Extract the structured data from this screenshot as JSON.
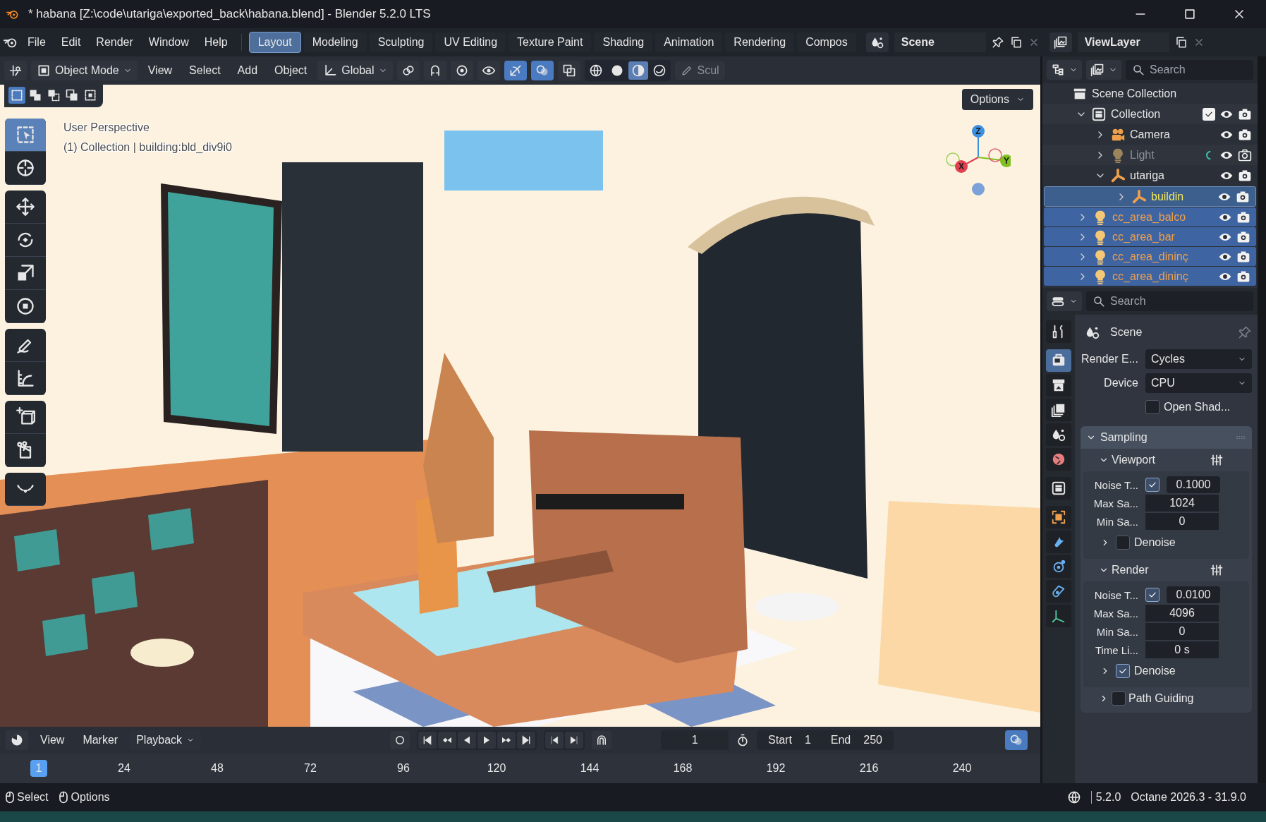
{
  "window": {
    "title": "* habana [Z:\\code\\utariga\\exported_back\\habana.blend] - Blender 5.2.0 LTS"
  },
  "menu": [
    "File",
    "Edit",
    "Render",
    "Window",
    "Help"
  ],
  "workspaces": [
    {
      "label": "Layout",
      "selected": true
    },
    {
      "label": "Modeling",
      "selected": false
    },
    {
      "label": "Sculpting",
      "selected": false
    },
    {
      "label": "UV Editing",
      "selected": false
    },
    {
      "label": "Texture Paint",
      "selected": false
    },
    {
      "label": "Shading",
      "selected": false
    },
    {
      "label": "Animation",
      "selected": false
    },
    {
      "label": "Rendering",
      "selected": false
    },
    {
      "label": "Compos",
      "selected": false
    }
  ],
  "scene": {
    "name": "Scene"
  },
  "view_layer": {
    "name": "ViewLayer"
  },
  "viewport_header": {
    "mode": "Object Mode",
    "menus": [
      "View",
      "Select",
      "Add",
      "Object"
    ],
    "orientation": "Global",
    "toggles": [
      {
        "kind": "snap",
        "on": false
      },
      {
        "kind": "proportional",
        "on": false
      },
      {
        "kind": "visibility",
        "on": false
      },
      {
        "kind": "gizmo",
        "on": true
      },
      {
        "kind": "overlay",
        "on": true
      },
      {
        "kind": "xray",
        "on": false
      }
    ],
    "shading": [
      {
        "kind": "wireframe",
        "selected": false
      },
      {
        "kind": "solid",
        "selected": false
      },
      {
        "kind": "material",
        "selected": true
      },
      {
        "kind": "rendered",
        "selected": false
      }
    ],
    "sculpt": "Scul"
  },
  "viewport": {
    "options": "Options",
    "perspective": "User Perspective",
    "info": "(1) Collection | building:bld_div9i0",
    "select_modes": [
      {
        "kind": "new",
        "selected": true
      },
      {
        "kind": "extend",
        "selected": false
      },
      {
        "kind": "subtract",
        "selected": false
      },
      {
        "kind": "invert",
        "selected": false
      },
      {
        "kind": "intersect",
        "selected": false
      }
    ],
    "tools": [
      {
        "kind": "select",
        "selected": true
      },
      {
        "kind": "cursor",
        "selected": false
      },
      {
        "kind": "move",
        "selected": false
      },
      {
        "kind": "rotate",
        "selected": false
      },
      {
        "kind": "scale",
        "selected": false
      },
      {
        "kind": "transform",
        "selected": false
      },
      {
        "kind": "annotate",
        "selected": false
      },
      {
        "kind": "measure",
        "selected": false
      },
      {
        "kind": "add_cube",
        "selected": false
      },
      {
        "kind": "cut",
        "selected": false
      },
      {
        "kind": "curve",
        "selected": false
      }
    ],
    "axes": [
      "Z",
      "X",
      "Y"
    ]
  },
  "outliner": {
    "search_placeholder": "Search",
    "tree": [
      {
        "label": "Scene Collection",
        "kind": "scene_collection",
        "children": [
          {
            "label": "Collection",
            "kind": "collection",
            "expanded": true,
            "checked": true,
            "selected": false,
            "render": true,
            "children": [
              {
                "label": "Camera",
                "kind": "camera",
                "expanded": false,
                "selected": false,
                "render": true
              },
              {
                "label": "Light",
                "kind": "light",
                "expanded": false,
                "selected": false,
                "render": false
              },
              {
                "label": "utariga",
                "kind": "empty",
                "expanded": true,
                "selected": false,
                "render": true,
                "children": [
                  {
                    "label": "buildin",
                    "kind": "empty",
                    "expanded": false,
                    "selected": true,
                    "active": true,
                    "render": true
                  }
                ]
              }
            ]
          },
          {
            "label": "cc_area_balco",
            "kind": "light",
            "expanded": false,
            "selected": true,
            "render": true
          },
          {
            "label": "cc_area_bar",
            "kind": "light",
            "expanded": false,
            "selected": true,
            "render": true
          },
          {
            "label": "cc_area_dininç",
            "kind": "light",
            "expanded": false,
            "selected": true,
            "render": true
          },
          {
            "label": "cc_area_dininç",
            "kind": "light",
            "expanded": false,
            "selected": true,
            "render": true
          }
        ]
      }
    ]
  },
  "properties": {
    "search_placeholder": "Search",
    "context": "Scene",
    "tabs": [
      {
        "kind": "tool",
        "selected": false
      },
      {
        "kind": "render",
        "selected": true
      },
      {
        "kind": "output",
        "selected": false
      },
      {
        "kind": "view_layer",
        "selected": false
      },
      {
        "kind": "scene",
        "selected": false
      },
      {
        "kind": "world",
        "selected": false
      },
      {
        "kind": "collection",
        "selected": false
      },
      {
        "kind": "object",
        "selected": false
      },
      {
        "kind": "modifier",
        "selected": false
      },
      {
        "kind": "physics",
        "selected": false
      },
      {
        "kind": "constraint",
        "selected": false
      },
      {
        "kind": "data",
        "selected": false
      }
    ],
    "fields": [
      {
        "label": "Render E...",
        "kind": "dropdown",
        "value": "Cycles"
      },
      {
        "label": "Device",
        "kind": "dropdown",
        "value": "CPU"
      },
      {
        "label": "Open Shad...",
        "kind": "checkbox",
        "checked": false
      }
    ],
    "panel": {
      "title": "Sampling",
      "expanded": true,
      "subpanels": [
        {
          "title": "Viewport",
          "expanded": true,
          "rows": [
            {
              "label": "Noise T...",
              "kind": "checknumber",
              "checked": true,
              "value": "0.1000"
            },
            {
              "label": "Max Sa...",
              "kind": "number",
              "value": "1024"
            },
            {
              "label": "Min Sa...",
              "kind": "number",
              "value": "0"
            },
            {
              "label": "Denoise",
              "kind": "subpanel",
              "checked": false,
              "expanded": false
            }
          ]
        },
        {
          "title": "Render",
          "expanded": true,
          "rows": [
            {
              "label": "Noise T...",
              "kind": "checknumber",
              "checked": true,
              "value": "0.0100"
            },
            {
              "label": "Max Sa...",
              "kind": "number",
              "value": "4096"
            },
            {
              "label": "Min Sa...",
              "kind": "number",
              "value": "0"
            },
            {
              "label": "Time Li...",
              "kind": "number",
              "value": "0 s"
            },
            {
              "label": "Denoise",
              "kind": "subpanel",
              "checked": true,
              "expanded": false
            }
          ]
        },
        {
          "title": "Path Guiding",
          "expanded": false,
          "checked": false
        }
      ]
    }
  },
  "timeline": {
    "menus": [
      {
        "label": "View",
        "kind": "menu"
      },
      {
        "label": "Marker",
        "kind": "menu"
      },
      {
        "label": "Playback",
        "kind": "dropdown"
      }
    ],
    "current_frame": "1",
    "start_label": "Start",
    "start": "1",
    "end_label": "End",
    "end": "250",
    "ruler": [
      {
        "label": "1",
        "selected": true
      },
      {
        "label": "24",
        "selected": false
      },
      {
        "label": "48",
        "selected": false
      },
      {
        "label": "72",
        "selected": false
      },
      {
        "label": "96",
        "selected": false
      },
      {
        "label": "120",
        "selected": false
      },
      {
        "label": "144",
        "selected": false
      },
      {
        "label": "168",
        "selected": false
      },
      {
        "label": "192",
        "selected": false
      },
      {
        "label": "216",
        "selected": false
      },
      {
        "label": "240",
        "selected": false
      }
    ]
  },
  "status_bar": {
    "hints": [
      "Select",
      "Options"
    ],
    "version": "5.2.0",
    "renderer": "Octane 2026.3 - 31.9.0"
  }
}
